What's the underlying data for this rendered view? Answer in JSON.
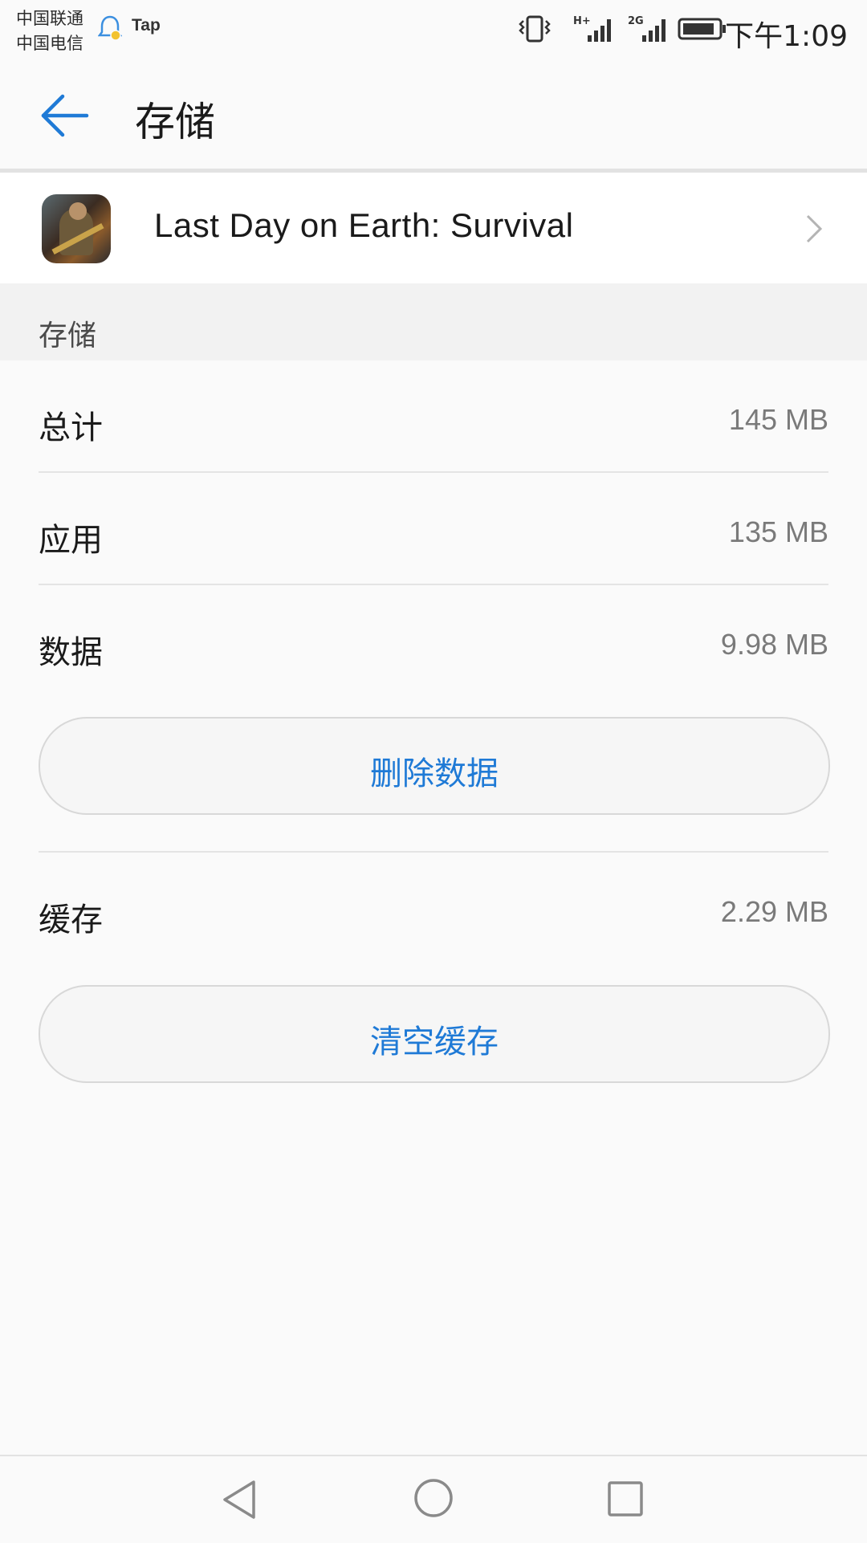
{
  "status_bar": {
    "carrier_1": "中国联通",
    "carrier_2": "中国电信",
    "app_badge": "Tap",
    "network_1": "H+",
    "network_2": "2G",
    "time": "下午1:09",
    "icons": [
      "bell-icon",
      "vibrate-icon",
      "signal-icon",
      "signal-icon",
      "battery-icon"
    ]
  },
  "header": {
    "title": "存储",
    "back_icon": "back-arrow-icon"
  },
  "app": {
    "name": "Last Day on Earth: Survival",
    "icon": "app-icon"
  },
  "storage_section": {
    "title": "存储",
    "rows": [
      {
        "label": "总计",
        "value": "145 MB"
      },
      {
        "label": "应用",
        "value": "135 MB"
      },
      {
        "label": "数据",
        "value": "9.98 MB"
      }
    ],
    "clear_data_button": "删除数据",
    "cache": {
      "label": "缓存",
      "value": "2.29 MB"
    },
    "clear_cache_button": "清空缓存"
  },
  "nav_bar": {
    "icons": [
      "nav-back-icon",
      "nav-home-icon",
      "nav-recent-icon"
    ]
  },
  "colors": {
    "accent": "#1f7ad6",
    "background": "#fafafa",
    "section_bg": "#f2f2f2",
    "secondary_text": "#7a7a7a"
  }
}
